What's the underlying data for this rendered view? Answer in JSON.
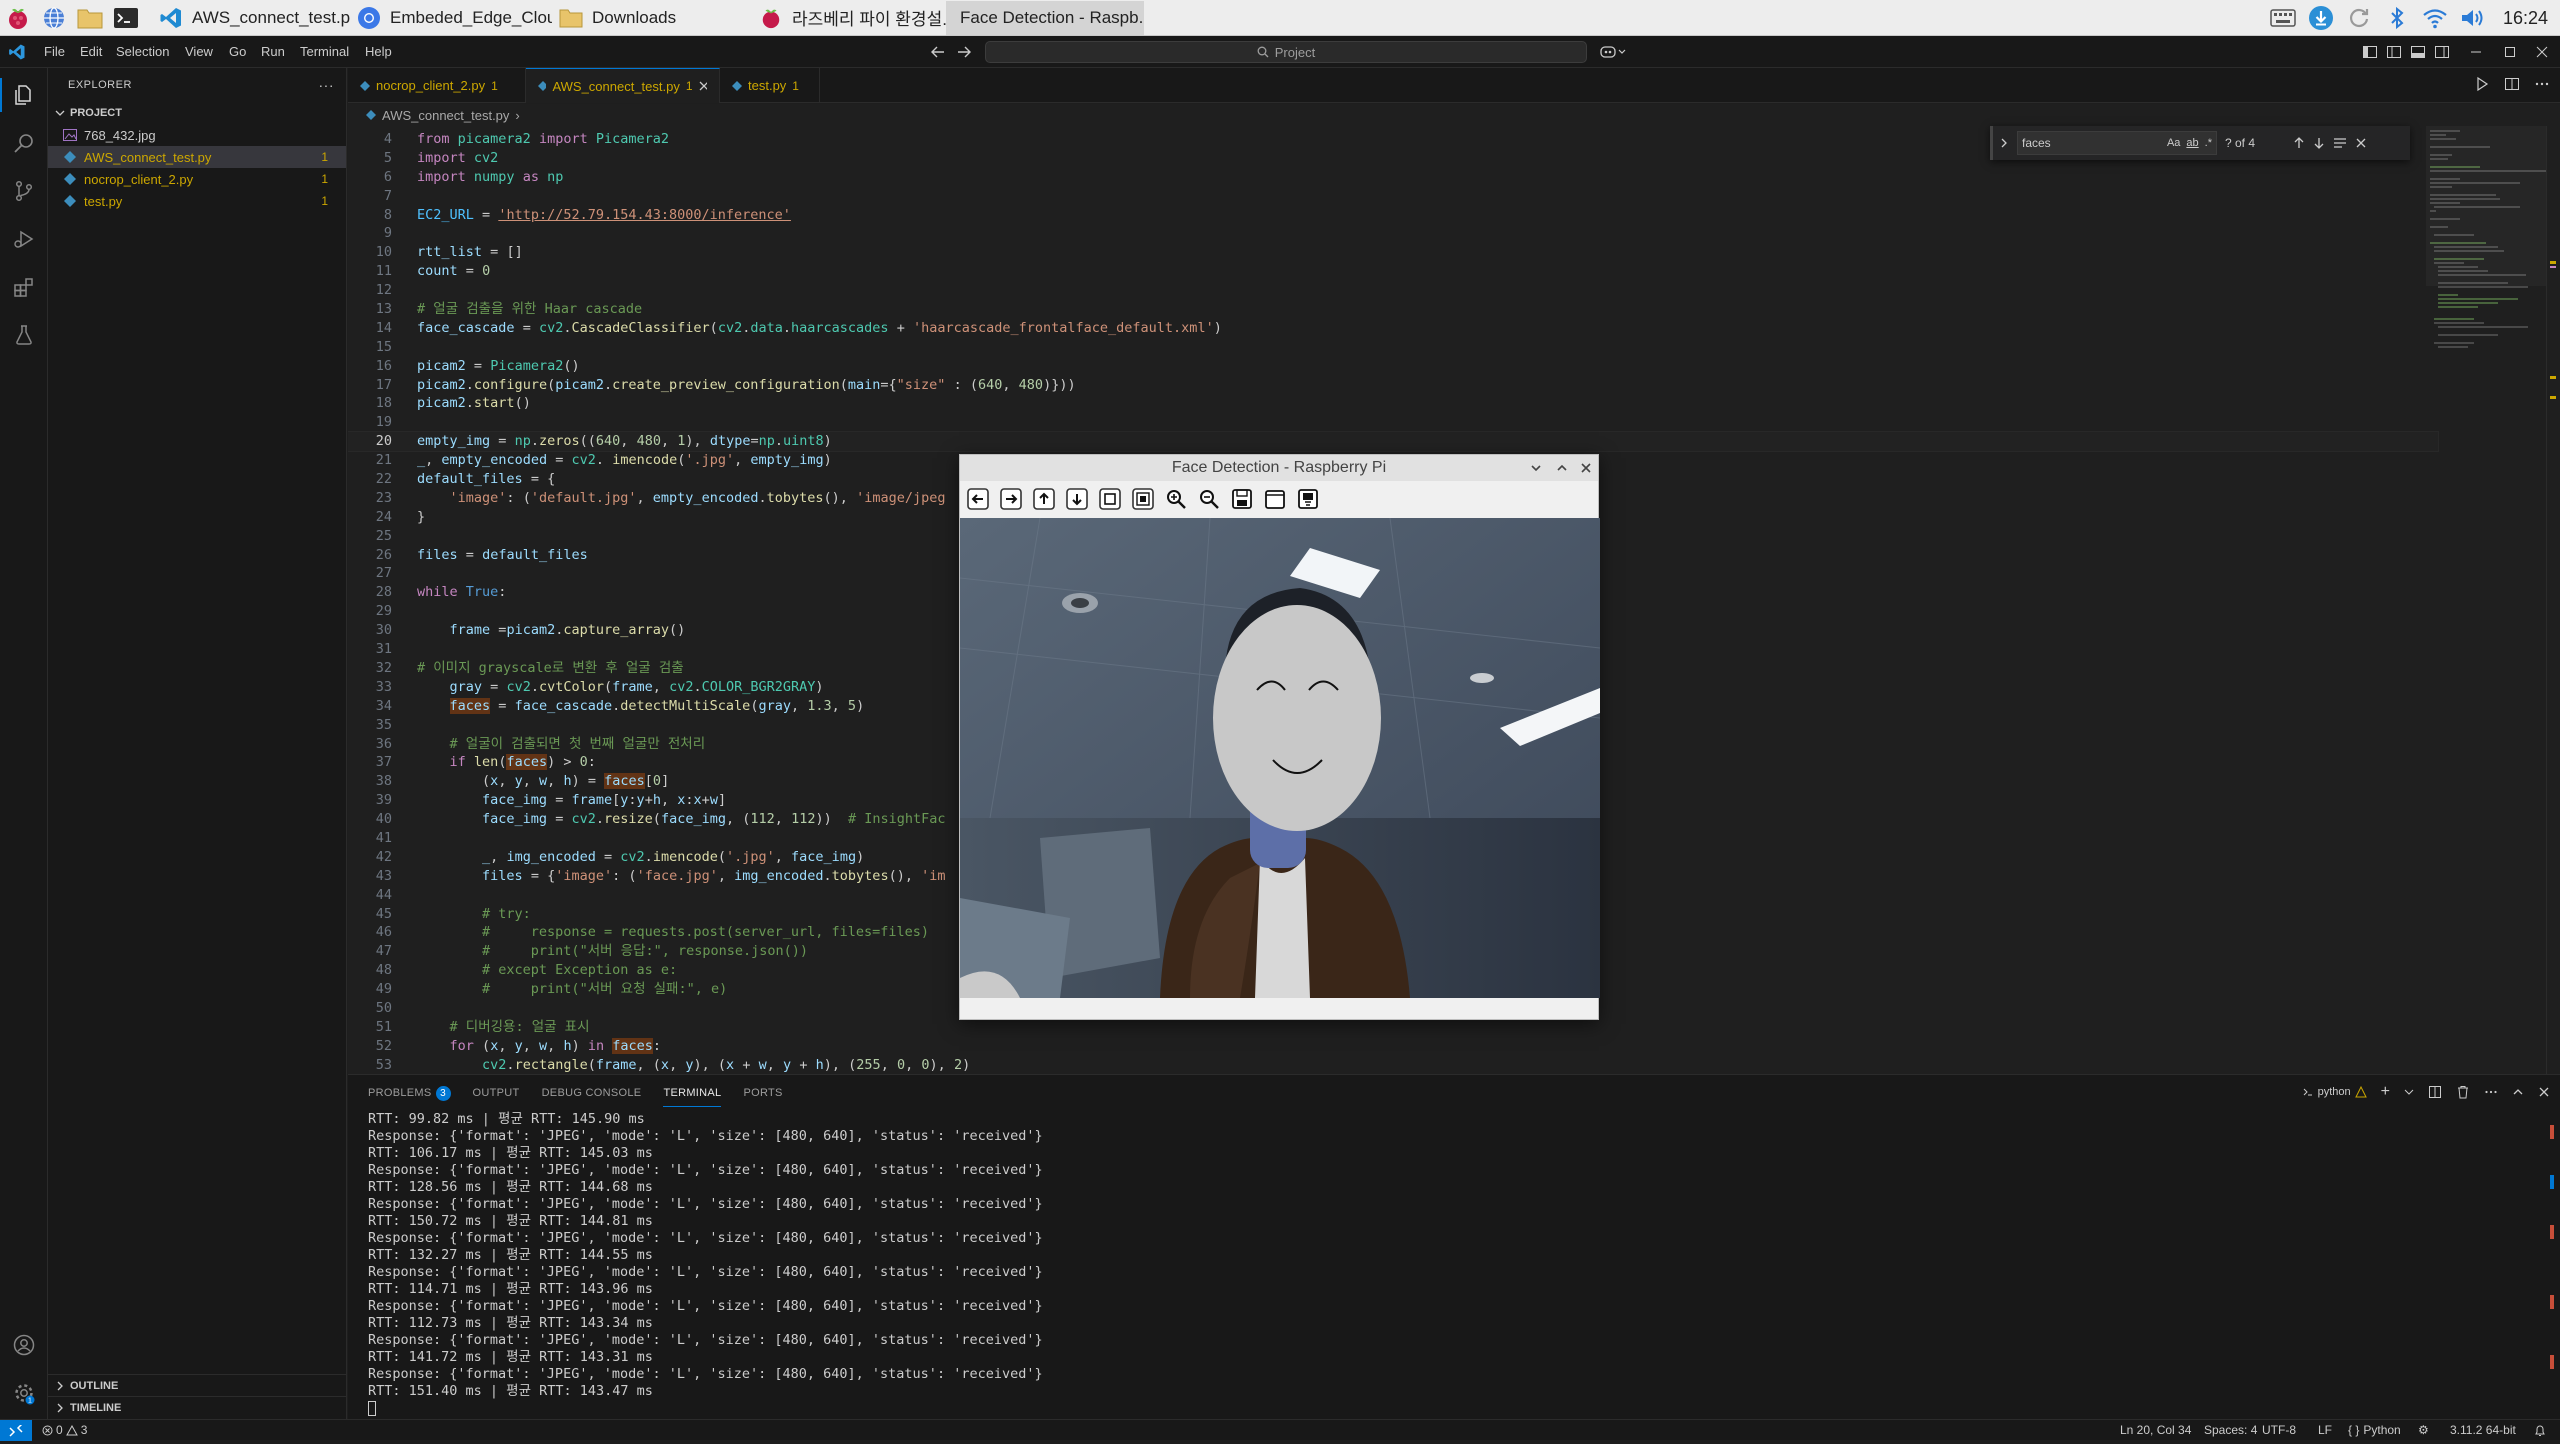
{
  "taskbar": {
    "tasks": [
      {
        "label": "AWS_connect_test.py...",
        "icon": "vscode-icon"
      },
      {
        "label": "Embeded_Edge_Clou...",
        "icon": "chromium-icon"
      },
      {
        "label": "Downloads",
        "icon": "folder-icon"
      },
      {
        "label": "라즈베리 파이 환경설...",
        "icon": "raspberry-icon"
      },
      {
        "label": "Face Detection - Raspb...",
        "icon": "none"
      }
    ],
    "clock": "16:24"
  },
  "menu": [
    "File",
    "Edit",
    "Selection",
    "View",
    "Go",
    "Run",
    "Terminal",
    "Help"
  ],
  "command_center": "Project",
  "explorer": {
    "title": "EXPLORER",
    "project": "PROJECT",
    "files": [
      {
        "name": "768_432.jpg",
        "badge": "",
        "color": "#cccccc",
        "icon": "image-file-icon"
      },
      {
        "name": "AWS_connect_test.py",
        "badge": "1",
        "color": "#cca700",
        "icon": "python-file-icon"
      },
      {
        "name": "nocrop_client_2.py",
        "badge": "1",
        "color": "#cca700",
        "icon": "python-file-icon"
      },
      {
        "name": "test.py",
        "badge": "1",
        "color": "#cca700",
        "icon": "python-file-icon"
      }
    ],
    "outline": "OUTLINE",
    "timeline": "TIMELINE"
  },
  "tabs": [
    {
      "label": "nocrop_client_2.py",
      "count": "1"
    },
    {
      "label": "AWS_connect_test.py",
      "count": "1"
    },
    {
      "label": "test.py",
      "count": "1"
    }
  ],
  "breadcrumb": "AWS_connect_test.py",
  "find": {
    "query": "faces",
    "count": "? of 4",
    "case": "Aa"
  },
  "code_lines": [
    {
      "n": "4",
      "t": "from picamera2 import Picamera2"
    },
    {
      "n": "5",
      "t": "import cv2"
    },
    {
      "n": "6",
      "t": "import numpy as np"
    },
    {
      "n": "7",
      "t": ""
    },
    {
      "n": "8",
      "t": "EC2_URL = 'http://52.79.154.43:8000/inference'"
    },
    {
      "n": "9",
      "t": ""
    },
    {
      "n": "10",
      "t": "rtt_list = []"
    },
    {
      "n": "11",
      "t": "count = 0"
    },
    {
      "n": "12",
      "t": ""
    },
    {
      "n": "13",
      "t": "# 얼굴 검출을 위한 Haar cascade"
    },
    {
      "n": "14",
      "t": "face_cascade = cv2.CascadeClassifier(cv2.data.haarcascades + 'haarcascade_frontalface_default.xml')"
    },
    {
      "n": "15",
      "t": ""
    },
    {
      "n": "16",
      "t": "picam2 = Picamera2()"
    },
    {
      "n": "17",
      "t": "picam2.configure(picam2.create_preview_configuration(main={\"size\" : (640, 480)}))"
    },
    {
      "n": "18",
      "t": "picam2.start()"
    },
    {
      "n": "19",
      "t": ""
    },
    {
      "n": "20",
      "t": "empty_img = np.zeros((640, 480, 1), dtype=np.uint8)"
    },
    {
      "n": "21",
      "t": "_, empty_encoded = cv2. imencode('.jpg', empty_img)"
    },
    {
      "n": "22",
      "t": "default_files = {"
    },
    {
      "n": "23",
      "t": "    'image': ('default.jpg', empty_encoded.tobytes(), 'image/jpeg"
    },
    {
      "n": "24",
      "t": "}"
    },
    {
      "n": "25",
      "t": ""
    },
    {
      "n": "26",
      "t": "files = default_files"
    },
    {
      "n": "27",
      "t": ""
    },
    {
      "n": "28",
      "t": "while True:"
    },
    {
      "n": "29",
      "t": ""
    },
    {
      "n": "30",
      "t": "    frame =picam2.capture_array()"
    },
    {
      "n": "31",
      "t": ""
    },
    {
      "n": "32",
      "t": "# 이미지 grayscale로 변환 후 얼굴 검출"
    },
    {
      "n": "33",
      "t": "    gray = cv2.cvtColor(frame, cv2.COLOR_BGR2GRAY)"
    },
    {
      "n": "34",
      "t": "    faces = face_cascade.detectMultiScale(gray, 1.3, 5)"
    },
    {
      "n": "35",
      "t": ""
    },
    {
      "n": "36",
      "t": "    # 얼굴이 검출되면 첫 번째 얼굴만 전처리"
    },
    {
      "n": "37",
      "t": "    if len(faces) > 0:"
    },
    {
      "n": "38",
      "t": "        (x, y, w, h) = faces[0]"
    },
    {
      "n": "39",
      "t": "        face_img = frame[y:y+h, x:x+w]"
    },
    {
      "n": "40",
      "t": "        face_img = cv2.resize(face_img, (112, 112))  # InsightFac"
    },
    {
      "n": "41",
      "t": ""
    },
    {
      "n": "42",
      "t": "        _, img_encoded = cv2.imencode('.jpg', face_img)"
    },
    {
      "n": "43",
      "t": "        files = {'image': ('face.jpg', img_encoded.tobytes(), 'im"
    },
    {
      "n": "44",
      "t": ""
    },
    {
      "n": "45",
      "t": "        # try:"
    },
    {
      "n": "46",
      "t": "        #     response = requests.post(server_url, files=files)"
    },
    {
      "n": "47",
      "t": "        #     print(\"서버 응답:\", response.json())"
    },
    {
      "n": "48",
      "t": "        # except Exception as e:"
    },
    {
      "n": "49",
      "t": "        #     print(\"서버 요청 실패:\", e)"
    },
    {
      "n": "50",
      "t": ""
    },
    {
      "n": "51",
      "t": "    # 디버깅용: 얼굴 표시"
    },
    {
      "n": "52",
      "t": "    for (x, y, w, h) in faces:"
    },
    {
      "n": "53",
      "t": "        cv2.rectangle(frame, (x, y), (x + w, y + h), (255, 0, 0), 2)"
    }
  ],
  "panel": {
    "tabs": [
      {
        "label": "PROBLEMS",
        "count": "3"
      },
      {
        "label": "OUTPUT",
        "count": ""
      },
      {
        "label": "DEBUG CONSOLE",
        "count": ""
      },
      {
        "label": "TERMINAL",
        "count": ""
      },
      {
        "label": "PORTS",
        "count": ""
      }
    ],
    "shell": "python",
    "terminal_lines": [
      "RTT: 99.82 ms | 평균 RTT: 145.90 ms",
      "Response: {'format': 'JPEG', 'mode': 'L', 'size': [480, 640], 'status': 'received'}",
      "RTT: 106.17 ms | 평균 RTT: 145.03 ms",
      "Response: {'format': 'JPEG', 'mode': 'L', 'size': [480, 640], 'status': 'received'}",
      "RTT: 128.56 ms | 평균 RTT: 144.68 ms",
      "Response: {'format': 'JPEG', 'mode': 'L', 'size': [480, 640], 'status': 'received'}",
      "RTT: 150.72 ms | 평균 RTT: 144.81 ms",
      "Response: {'format': 'JPEG', 'mode': 'L', 'size': [480, 640], 'status': 'received'}",
      "RTT: 132.27 ms | 평균 RTT: 144.55 ms",
      "Response: {'format': 'JPEG', 'mode': 'L', 'size': [480, 640], 'status': 'received'}",
      "RTT: 114.71 ms | 평균 RTT: 143.96 ms",
      "Response: {'format': 'JPEG', 'mode': 'L', 'size': [480, 640], 'status': 'received'}",
      "RTT: 112.73 ms | 평균 RTT: 143.34 ms",
      "Response: {'format': 'JPEG', 'mode': 'L', 'size': [480, 640], 'status': 'received'}",
      "RTT: 141.72 ms | 평균 RTT: 143.31 ms",
      "Response: {'format': 'JPEG', 'mode': 'L', 'size': [480, 640], 'status': 'received'}",
      "RTT: 151.40 ms | 평균 RTT: 143.47 ms"
    ]
  },
  "statusbar": {
    "problems": "0",
    "warnings": "3",
    "position": "Ln 20, Col 34",
    "spaces": "Spaces: 4",
    "encoding": "UTF-8",
    "eol": "LF",
    "language": "Python",
    "interpreter": "3.11.2 64-bit"
  },
  "cv_window": {
    "title": "Face Detection - Raspberry Pi"
  },
  "colors": {
    "accent": "#0078d4",
    "keyword": "#c586c0",
    "string": "#ce9178",
    "comment": "#6a9955",
    "function": "#dcdcaa",
    "variable": "#9cdcfe",
    "class": "#4ec9b0",
    "number": "#b5cea8",
    "warning": "#cca700"
  }
}
